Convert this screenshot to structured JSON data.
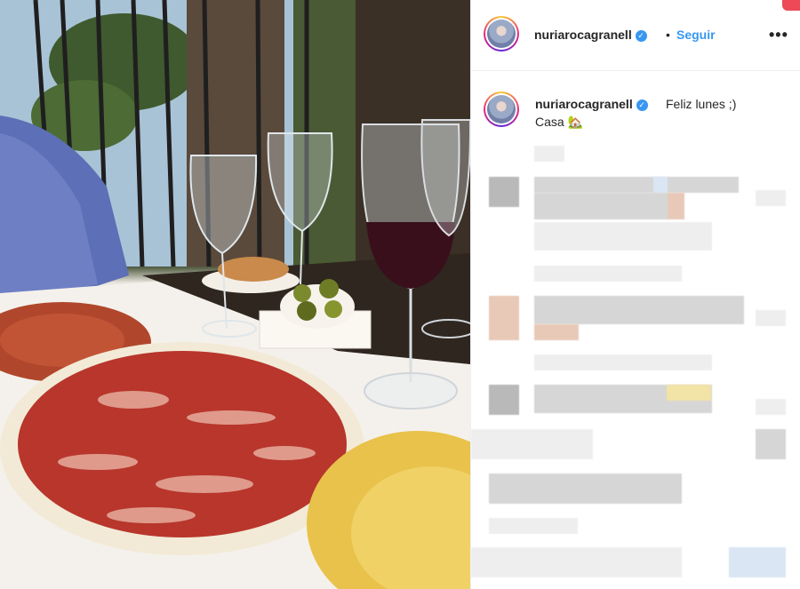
{
  "post": {
    "username": "nuriarocagranell",
    "verified_badge": "✓",
    "separator": "•",
    "follow_label": "Seguir",
    "more_label": "•••",
    "caption_line1": "Feliz lunes ;)",
    "caption_line2": "Casa",
    "caption_emoji": "🏡"
  },
  "icons": {
    "verified": "verified-badge-icon",
    "more": "more-options-icon",
    "avatar": "profile-avatar"
  },
  "colors": {
    "link_blue": "#3897f0",
    "border": "#efefef",
    "text": "#262626"
  }
}
